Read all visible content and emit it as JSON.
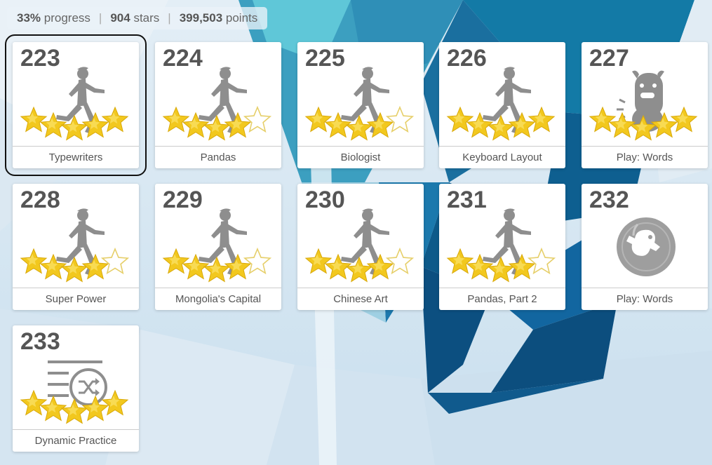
{
  "stats": {
    "progress_value": "33%",
    "progress_label": "progress",
    "stars_value": "904",
    "stars_label": "stars",
    "points_value": "399,503",
    "points_label": "points"
  },
  "lessons": [
    {
      "number": "223",
      "title": "Typewriters",
      "icon": "runner-icon",
      "stars_earned": 5,
      "stars_total": 5,
      "selected": true
    },
    {
      "number": "224",
      "title": "Pandas",
      "icon": "runner-icon",
      "stars_earned": 4,
      "stars_total": 5,
      "selected": false
    },
    {
      "number": "225",
      "title": "Biologist",
      "icon": "runner-icon",
      "stars_earned": 4,
      "stars_total": 5,
      "selected": false
    },
    {
      "number": "226",
      "title": "Keyboard Layout",
      "icon": "runner-icon",
      "stars_earned": 5,
      "stars_total": 5,
      "selected": false
    },
    {
      "number": "227",
      "title": "Play: Words",
      "icon": "monster-icon",
      "stars_earned": 5,
      "stars_total": 5,
      "selected": false
    },
    {
      "number": "228",
      "title": "Super Power",
      "icon": "runner-icon",
      "stars_earned": 4,
      "stars_total": 5,
      "selected": false
    },
    {
      "number": "229",
      "title": "Mongolia's Capital",
      "icon": "runner-icon",
      "stars_earned": 4,
      "stars_total": 5,
      "selected": false
    },
    {
      "number": "230",
      "title": "Chinese Art",
      "icon": "runner-icon",
      "stars_earned": 4,
      "stars_total": 5,
      "selected": false
    },
    {
      "number": "231",
      "title": "Pandas, Part 2",
      "icon": "runner-icon",
      "stars_earned": 4,
      "stars_total": 5,
      "selected": false
    },
    {
      "number": "232",
      "title": "Play: Words",
      "icon": "locked-bubble-icon",
      "stars_earned": 0,
      "stars_total": 0,
      "selected": false
    },
    {
      "number": "233",
      "title": "Dynamic Practice",
      "icon": "shuffle-lines-icon",
      "stars_earned": 5,
      "stars_total": 5,
      "selected": false
    }
  ],
  "colors": {
    "star_fill": "#f2c81e",
    "star_highlight": "#fbe36a",
    "star_empty_stroke": "#e6cf6a",
    "icon_gray": "#8e8e8e",
    "bg_blue_dark": "#0f5e93",
    "bg_blue_light": "#cfe3f0"
  }
}
